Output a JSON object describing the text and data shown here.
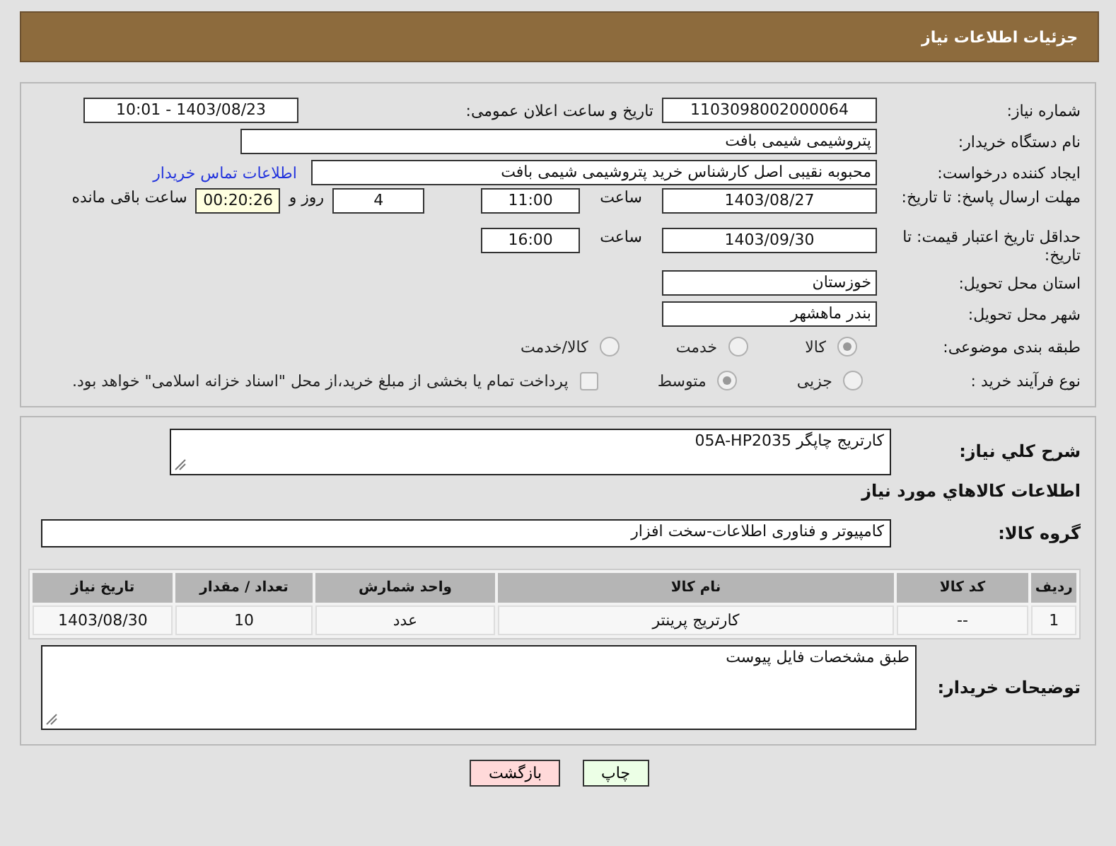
{
  "header": {
    "title": "جزئیات اطلاعات نیاز"
  },
  "need_number": {
    "label": "شماره نیاز:",
    "value": "1103098002000064"
  },
  "announce": {
    "label": "تاریخ و ساعت اعلان عمومی:",
    "value": "1403/08/23 - 10:01"
  },
  "buyer": {
    "label": "نام دستگاه خریدار:",
    "value": "پتروشیمی شیمی بافت"
  },
  "requester": {
    "label": "ایجاد کننده درخواست:",
    "value": "محبوبه نقیبی اصل کارشناس خرید پتروشیمی شیمی بافت",
    "link": "اطلاعات تماس خریدار"
  },
  "reply_deadline": {
    "label": "مهلت ارسال پاسخ: تا تاریخ:",
    "date": "1403/08/27",
    "time_label": "ساعت",
    "time": "11:00",
    "days": "4",
    "days_label": "روز و",
    "remaining": "00:20:26",
    "remaining_label": "ساعت باقی مانده"
  },
  "price_validity": {
    "label": "حداقل تاریخ اعتبار قیمت: تا تاریخ:",
    "date": "1403/09/30",
    "time_label": "ساعت",
    "time": "16:00"
  },
  "province": {
    "label": "استان محل تحویل:",
    "value": "خوزستان"
  },
  "city": {
    "label": "شهر محل تحویل:",
    "value": "بندر ماهشهر"
  },
  "category": {
    "label": "طبقه بندی موضوعی:",
    "options": [
      {
        "label": "کالا",
        "selected": true
      },
      {
        "label": "خدمت",
        "selected": false
      },
      {
        "label": "کالا/خدمت",
        "selected": false
      }
    ]
  },
  "process": {
    "label": "نوع فرآیند خرید :",
    "options": [
      {
        "label": "جزیی",
        "selected": false
      },
      {
        "label": "متوسط",
        "selected": true
      }
    ],
    "payment": {
      "checked": false,
      "text": "پرداخت تمام یا بخشی از مبلغ خرید،از محل \"اسناد خزانه اسلامی\" خواهد بود."
    }
  },
  "description": {
    "label": "شرح کلي نياز:",
    "value": "کارتریج چاپگر 05A-HP2035"
  },
  "goods_title": "اطلاعات کالاهاي مورد نياز",
  "group": {
    "label": "گروه کالا:",
    "value": "کامپیوتر و فناوری اطلاعات-سخت افزار"
  },
  "table": {
    "columns": [
      "ردیف",
      "کد کالا",
      "نام کالا",
      "واحد شمارش",
      "تعداد / مقدار",
      "تاریخ نیاز"
    ],
    "rows": [
      [
        "1",
        "--",
        "کارتریج پرینتر",
        "عدد",
        "10",
        "1403/08/30"
      ]
    ]
  },
  "buyer_notes": {
    "label": "توضیحات خریدار:",
    "value": "طبق مشخصات فایل پیوست"
  },
  "buttons": [
    {
      "kind": "print",
      "label": "چاپ"
    },
    {
      "kind": "back",
      "label": "بازگشت"
    }
  ]
}
